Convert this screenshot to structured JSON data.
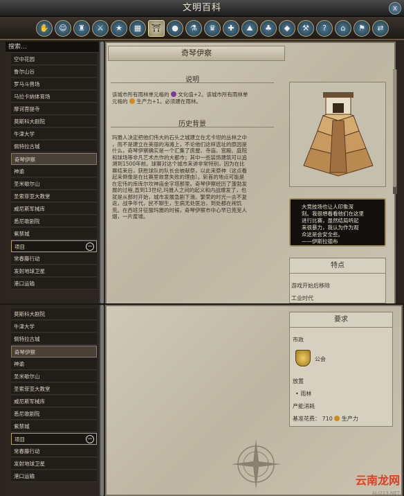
{
  "title": "文明百科",
  "close": "x",
  "icons": [
    "handshake-icon",
    "civ-leader-icon",
    "city-state-icon",
    "unit-icon",
    "promotion-icon",
    "building-icon",
    "wonder-icon",
    "specialist-icon",
    "tech-icon",
    "policy-icon",
    "religion-icon",
    "terrain-icon",
    "feature-icon",
    "resource-icon",
    "improvement-icon",
    "gameplay-icon",
    "city-icon",
    "victory-icon",
    "trade-icon"
  ],
  "icon_glyphs": [
    "✋",
    "☺",
    "♜",
    "⚔",
    "★",
    "▦",
    "⛩",
    "●",
    "⚗",
    "♛",
    "✚",
    "⛰",
    "♣",
    "◆",
    "⚒",
    "?",
    "⌂",
    "⚑",
    "⇄"
  ],
  "search": "搜索…",
  "sidebar1": [
    "空中花园",
    "鲁尔山谷",
    "罗马斗兽场",
    "马拉卡纳体育场",
    "摩诃菩提寺",
    "莫斯科大剧院",
    "牛津大学",
    "佩特拉古城",
    "奇琴伊察",
    "神谕",
    "圣米歇尔山",
    "圣索菲亚大教堂",
    "威尼斯军械库",
    "悉尼歌剧院",
    "紫禁城",
    "项目",
    "常春藤行动",
    "发射地球卫星",
    "港口运输"
  ],
  "sidebar2": [
    "莫斯科大剧院",
    "牛津大学",
    "佩特拉古城",
    "奇琴伊察",
    "神谕",
    "圣米歇尔山",
    "圣索菲亚大教堂",
    "威尼斯军械库",
    "悉尼歌剧院",
    "紫禁城",
    "项目",
    "常春藤行动",
    "发射地球卫星",
    "港口运输"
  ],
  "page_title": "奇琴伊察",
  "desc_head": "说明",
  "desc_l1": "该城市所有雨林单元格的",
  "desc_l1b": "文化值+2。该城市所有雨林单",
  "desc_l2": "元格的",
  "desc_l2b": "生产力+1。必须建在雨林。",
  "hist_head": "历史背景",
  "history": [
    "玛雅人决定把他们伟大的石头之城建立在尤卡坦的丛林之中",
    "，而不是建立在美丽的海滩上，不论他们这样选址的原因是",
    "什么，奇琴伊察确实是一个汇集了房屋、寺庙、宫殿、庭院",
    "和球场等非凡艺术杰作的大都市；其中一些装饰建筑可以追",
    "溯到1500年前。球赛对这个城市来讲非常特别，因为在比",
    "赛结束后，获胜球队的队长会被献祭，以此来祭神（这点看",
    "起来倒像是在比赛里故意失败的理由）。斩首的地点可能是",
    "在宏伟的库库尔坎神庙金字塔那里。奇琴伊察经历了蓬勃发",
    "展的过程,直到13世纪,玛雅人之间的起义和内战爆发了，也",
    "就是从那时开始，城市发展急剧下滑。繁荣的时光一去不复",
    "返，战争年代，民不聊生，生病无处医治，到处都在闹饥",
    "荒。在西班牙征服玛雅的时候，奇琴伊察市中心早已荒芜人",
    "烟，一片废墟。"
  ],
  "quote": [
    "大竞技场也让人印象深",
    "刻。我很想看看他们在这里",
    "进行比赛，虽然结局听起",
    "来很暴力，我认为作为观",
    "众这是会安全些。",
    "——伊斯拉德布"
  ],
  "traits_head": "特点",
  "traits_l1": "游戏开始后移除",
  "traits_l2": "工业时代",
  "req_head": "要求",
  "gov_label": "市政",
  "gov_value": "公会",
  "place_label": "放置",
  "place_value": "雨林",
  "cost_label": "产能消耗",
  "cost_line": "基准花费：",
  "cost_value": "710",
  "cost_unit": "生产力",
  "watermark": "云南龙网",
  "watermark2": "ALI213.NET",
  "colors": {
    "culture": "#7a3a9a",
    "production": "#d08a20"
  }
}
